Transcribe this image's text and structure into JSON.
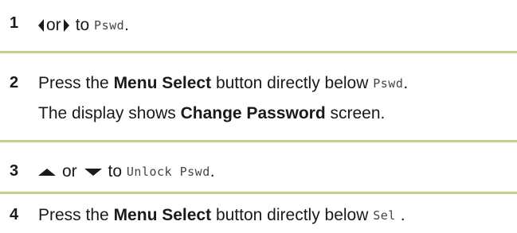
{
  "steps": [
    {
      "number": "1",
      "or_text": "or",
      "to_text": "to",
      "display_term": "Pswd",
      "end": "."
    },
    {
      "number": "2",
      "prefix": "Press the",
      "button_name": "Menu Select",
      "suffix": "button directly below",
      "display_term": "Pswd",
      "end": ".",
      "line2_prefix": "The display shows",
      "screen_name": "Change Password",
      "line2_suffix": "screen."
    },
    {
      "number": "3",
      "or_text": "or",
      "to_text": "to",
      "display_term": "Unlock Pswd",
      "end": "."
    },
    {
      "number": "4",
      "prefix": "Press the",
      "button_name": "Menu Select",
      "suffix": "button directly below",
      "display_term": "Sel",
      "end": "."
    }
  ],
  "icons": {
    "step1_left": "left-arrow-icon",
    "step1_right": "right-arrow-icon",
    "step3_up": "up-arrow-icon",
    "step3_down": "down-arrow-icon"
  },
  "colors": {
    "separator": "#c6cf8a",
    "text": "#1a1a1a"
  }
}
